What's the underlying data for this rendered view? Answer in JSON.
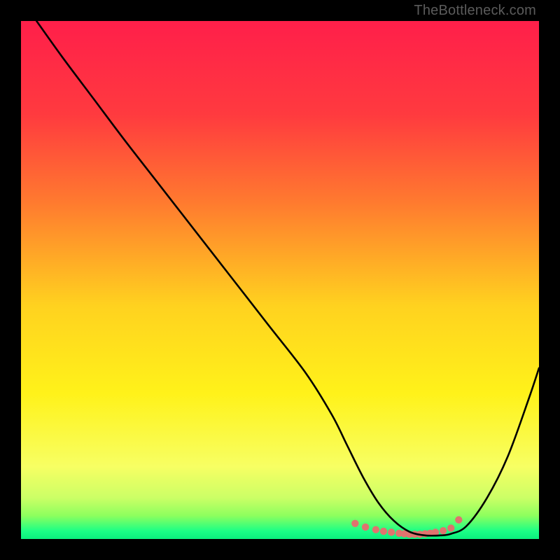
{
  "watermark": "TheBottleneck.com",
  "chart_data": {
    "type": "line",
    "title": "",
    "xlabel": "",
    "ylabel": "",
    "xlim": [
      0,
      100
    ],
    "ylim": [
      0,
      100
    ],
    "grid": false,
    "legend": false,
    "gradient_stops": [
      {
        "offset": 0.0,
        "color": "#ff1f4a"
      },
      {
        "offset": 0.18,
        "color": "#ff3a3f"
      },
      {
        "offset": 0.35,
        "color": "#ff7a2f"
      },
      {
        "offset": 0.55,
        "color": "#ffd21f"
      },
      {
        "offset": 0.72,
        "color": "#fff21a"
      },
      {
        "offset": 0.86,
        "color": "#f7ff63"
      },
      {
        "offset": 0.92,
        "color": "#ccff66"
      },
      {
        "offset": 0.955,
        "color": "#8dff5e"
      },
      {
        "offset": 0.985,
        "color": "#1bff86"
      },
      {
        "offset": 1.0,
        "color": "#0bf07e"
      }
    ],
    "series": [
      {
        "name": "bottleneck-curve",
        "color": "#000000",
        "x": [
          3,
          8,
          14,
          20,
          27,
          34,
          41,
          48,
          55,
          60,
          63,
          66,
          69,
          72,
          75,
          78,
          81,
          83,
          86,
          90,
          94,
          98,
          100
        ],
        "y": [
          100,
          93,
          85,
          77,
          68,
          59,
          50,
          41,
          32,
          24,
          18,
          12,
          7,
          3.5,
          1.4,
          0.7,
          0.7,
          1.0,
          2.5,
          8,
          16,
          27,
          33
        ]
      }
    ],
    "marker_points": {
      "name": "optimal-range-dots",
      "color": "#e0736e",
      "radius": 5.2,
      "x": [
        64.5,
        66.5,
        68.5,
        70,
        71.5,
        73,
        74,
        75,
        76,
        77,
        78,
        79,
        80,
        81.5,
        83,
        84.5
      ],
      "y": [
        3.0,
        2.3,
        1.8,
        1.5,
        1.3,
        1.1,
        1.0,
        0.9,
        0.9,
        0.9,
        1.0,
        1.1,
        1.3,
        1.6,
        2.1,
        3.7
      ]
    }
  }
}
